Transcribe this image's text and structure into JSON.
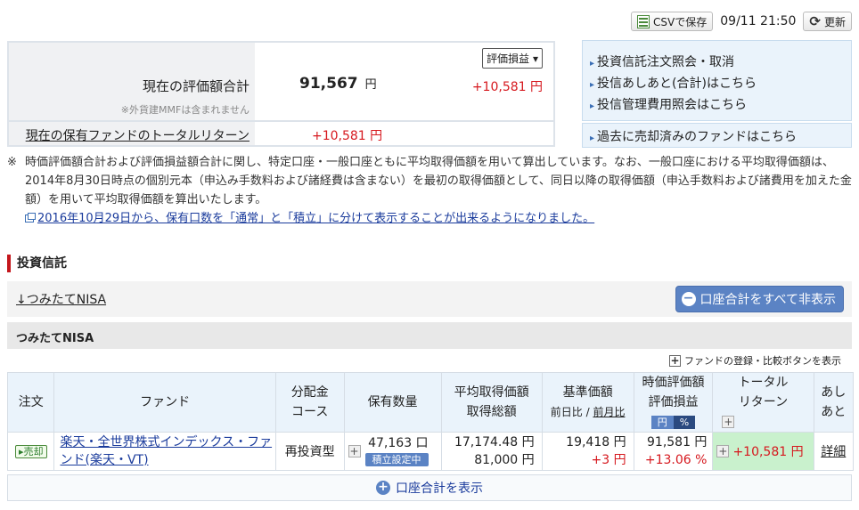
{
  "topbar": {
    "csv_label": "CSVで保存",
    "timestamp": "09/11 21:50",
    "refresh_label": "更新"
  },
  "summary": {
    "eval_total_label": "現在の評価額合計",
    "foreign_mmf_note": "※外貨建MMFは含まれません",
    "eval_select_value": "評価損益",
    "eval_total_value": "91,567",
    "unit_yen": "円",
    "eval_gain": "+10,581 円",
    "total_return_label": "現在の保有ファンドのトータルリターン",
    "total_return_value": "+10,581 円"
  },
  "links": {
    "items": [
      "投資信託注文照会・取消",
      "投信あしあと(合計)はこちら",
      "投信管理費用照会はこちら"
    ],
    "past_funds": "過去に売却済みのファンドはこちら"
  },
  "notes": {
    "mark": "※",
    "text": "時価評価額合計および評価損益額合計に関し、特定口座・一般口座ともに平均取得価額を用いて算出しています。なお、一般口座における平均取得価額は、2014年8月30日時点の個別元本（申込み手数料および諸経費は含まない）を最初の取得価額として、同日以降の取得価額（申込手数料および諸費用を加えた金額）を用いて平均取得価額を算出いたします。",
    "notice_link": "2016年10月29日から、保有口数を「通常」と「積立」に分けて表示することが出来るようになりました。"
  },
  "section": {
    "title": "投資信託",
    "anchor_link": "↓つみたてNISA",
    "hide_all_button": "口座合計をすべて非表示",
    "account_name": "つみたてNISA",
    "compare_toggle": "ファンドの登録・比較ボタンを表示"
  },
  "table": {
    "headers": {
      "order": "注文",
      "fund": "ファンド",
      "dist_1": "分配金",
      "dist_2": "コース",
      "qty": "保有数量",
      "avg_1": "平均取得価額",
      "avg_2": "取得総額",
      "base_1": "基準価額",
      "base_prev_day": "前日比",
      "base_sep": " / ",
      "base_prev_month": "前月比",
      "mkt_1": "時価評価額",
      "mkt_2": "評価損益",
      "toggle_yen": "円",
      "toggle_pct": "%",
      "tr_1": "トータル",
      "tr_2": "リターン",
      "ash_1": "あし",
      "ash_2": "あと"
    },
    "rows": [
      {
        "order_badge": "▸売却",
        "fund_name": "楽天・全世界株式インデックス・ファンド(楽天・VT)",
        "dist_course": "再投資型",
        "quantity": "47,163 口",
        "tsumitate_badge": "積立設定中",
        "avg_price": "17,174.48 円",
        "total_cost": "81,000 円",
        "base_price": "19,418 円",
        "base_change": "+3 円",
        "market_value": "91,581 円",
        "eval_pct": "+13.06 %",
        "total_return": "+10,581 円",
        "detail_link": "詳細"
      }
    ]
  },
  "show_total_button": "口座合計を表示",
  "colors": {
    "accent_red": "#d6181e",
    "button_blue": "#5b83c4",
    "return_green": "#c9f1cd",
    "section_bar": "#c4161c"
  }
}
